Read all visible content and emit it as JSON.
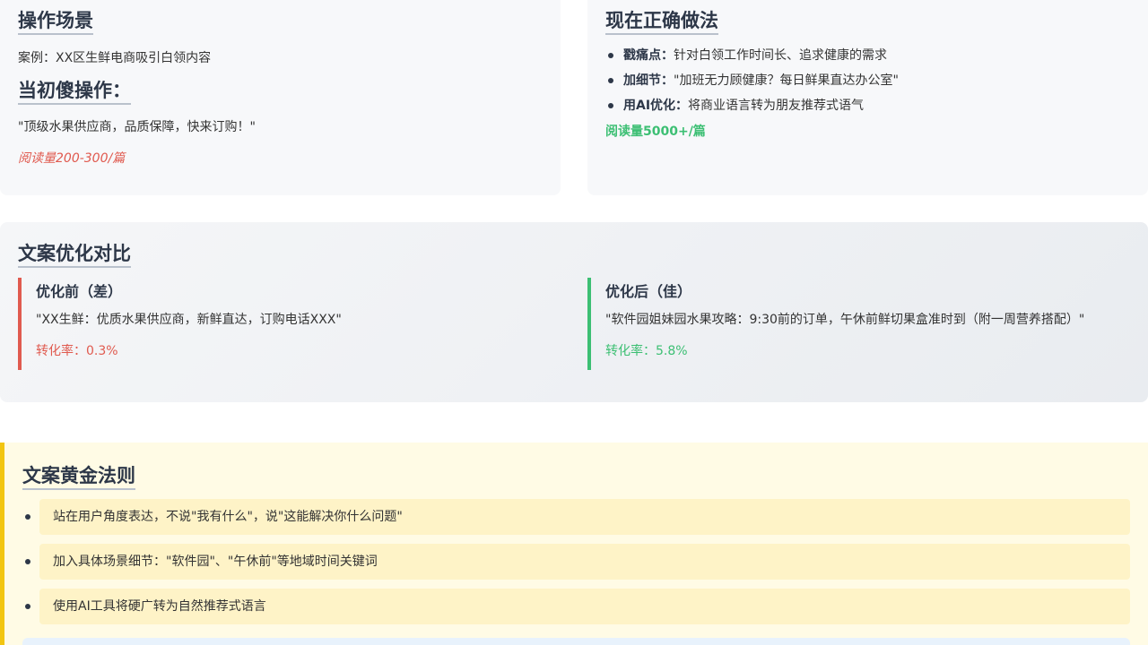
{
  "scene": {
    "title": "操作场景",
    "case": "案例：XX区生鲜电商吸引白领内容",
    "naive_title": "当初傻操作：",
    "naive_quote": "\"顶级水果供应商，品质保障，快来订购！\"",
    "naive_reads": "阅读量200-300/篇"
  },
  "correct": {
    "title": "现在正确做法",
    "items": [
      {
        "label": "戳痛点：",
        "text": "针对白领工作时间长、追求健康的需求"
      },
      {
        "label": "加细节：",
        "text": "\"加班无力顾健康？每日鲜果直达办公室\""
      },
      {
        "label": "用AI优化：",
        "text": "将商业语言转为朋友推荐式语气"
      }
    ],
    "reads": "阅读量5000+/篇"
  },
  "compare": {
    "title": "文案优化对比",
    "before": {
      "title": "优化前（差）",
      "quote": "\"XX生鲜：优质水果供应商，新鲜直达，订购电话XXX\"",
      "rate": "转化率：0.3%"
    },
    "after": {
      "title": "优化后（佳）",
      "quote": "\"软件园姐妹园水果攻略：9:30前的订单，午休前鲜切果盒准时到（附一周营养搭配）\"",
      "rate": "转化率：5.8%"
    }
  },
  "rules": {
    "title": "文案黄金法则",
    "items": [
      "站在用户角度表达，不说\"我有什么\"，说\"这能解决你什么问题\"",
      "加入具体场景细节：\"软件园\"、\"午休前\"等地域时间关键词",
      "使用AI工具将硬广转为自然推荐式语言"
    ]
  },
  "colors": {
    "bad": "#e05a4f",
    "good": "#3cbf73",
    "rules_accent": "#f2c511",
    "rules_bg": "#fffbe5",
    "rule_item_bg": "#fef3c7"
  }
}
